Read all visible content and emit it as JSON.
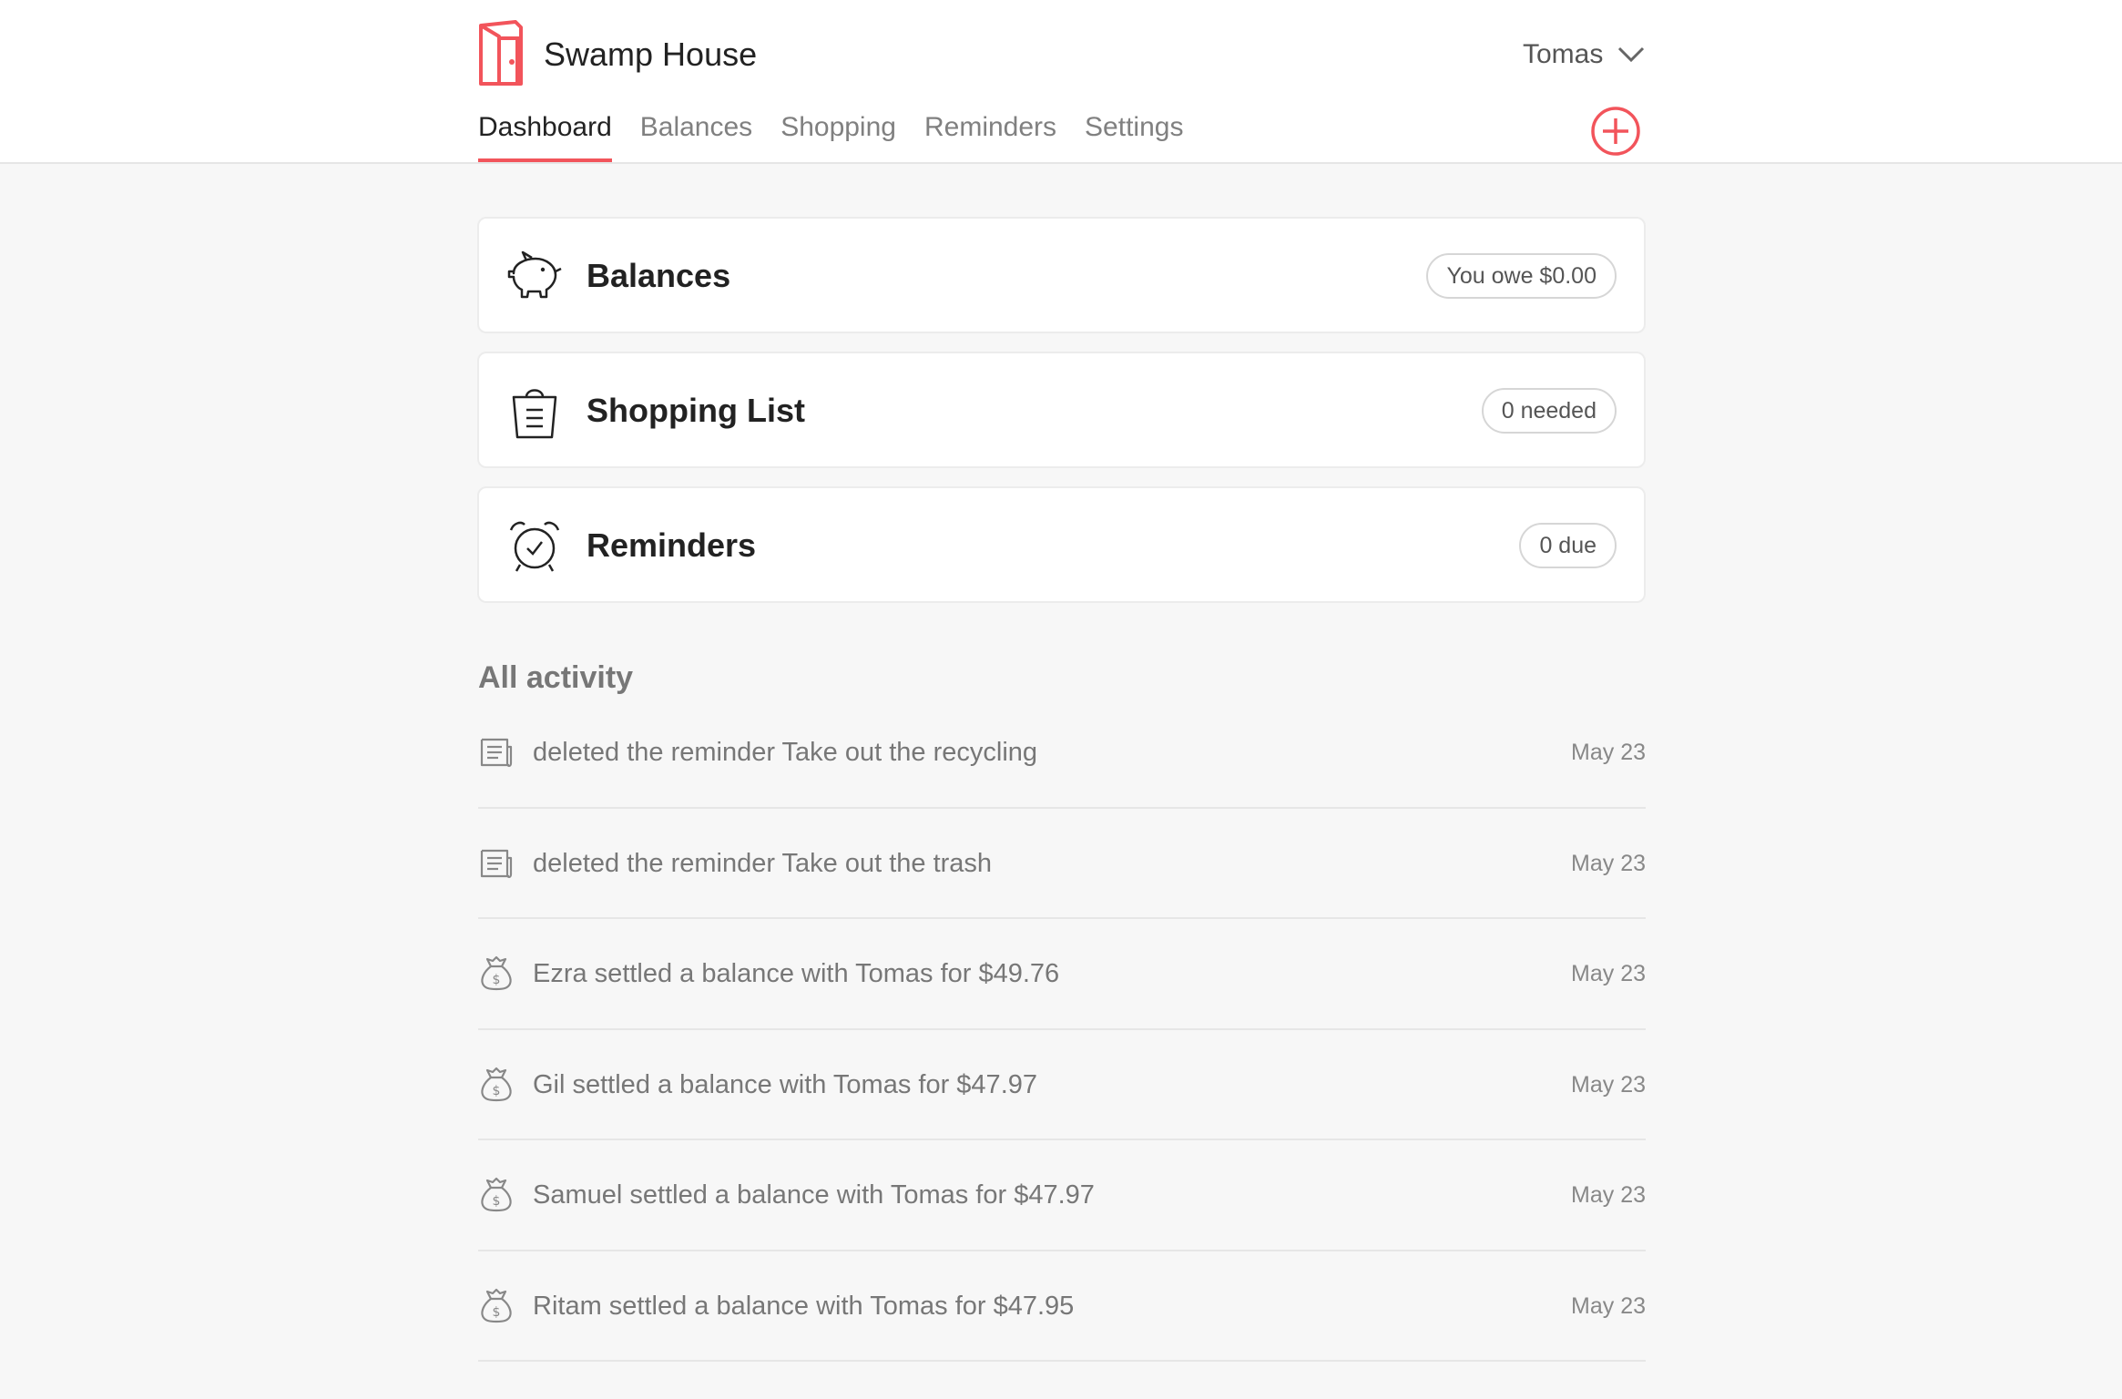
{
  "app": {
    "title": "Swamp House",
    "accent_color": "#f2545b",
    "logo_icon": "door-icon"
  },
  "user_menu": {
    "name": "Tomas",
    "icon": "chevron-down-icon"
  },
  "nav": {
    "tabs": [
      {
        "label": "Dashboard",
        "active": true
      },
      {
        "label": "Balances",
        "active": false
      },
      {
        "label": "Shopping",
        "active": false
      },
      {
        "label": "Reminders",
        "active": false
      },
      {
        "label": "Settings",
        "active": false
      }
    ],
    "add_icon": "plus-circle-icon"
  },
  "cards": [
    {
      "title": "Balances",
      "badge": "You owe $0.00",
      "icon": "piggy-bank-icon"
    },
    {
      "title": "Shopping List",
      "badge": "0 needed",
      "icon": "shopping-bag-icon"
    },
    {
      "title": "Reminders",
      "badge": "0 due",
      "icon": "alarm-clock-icon"
    }
  ],
  "activity": {
    "heading": "All activity",
    "items": [
      {
        "text": "deleted the reminder Take out the recycling",
        "date": "May 23",
        "icon": "document-icon"
      },
      {
        "text": "deleted the reminder Take out the trash",
        "date": "May 23",
        "icon": "document-icon"
      },
      {
        "text": "Ezra settled a balance with Tomas for $49.76",
        "date": "May 23",
        "icon": "money-bag-icon"
      },
      {
        "text": "Gil settled a balance with Tomas for $47.97",
        "date": "May 23",
        "icon": "money-bag-icon"
      },
      {
        "text": "Samuel settled a balance with Tomas for $47.97",
        "date": "May 23",
        "icon": "money-bag-icon"
      },
      {
        "text": "Ritam settled a balance with Tomas for $47.95",
        "date": "May 23",
        "icon": "money-bag-icon"
      }
    ]
  }
}
